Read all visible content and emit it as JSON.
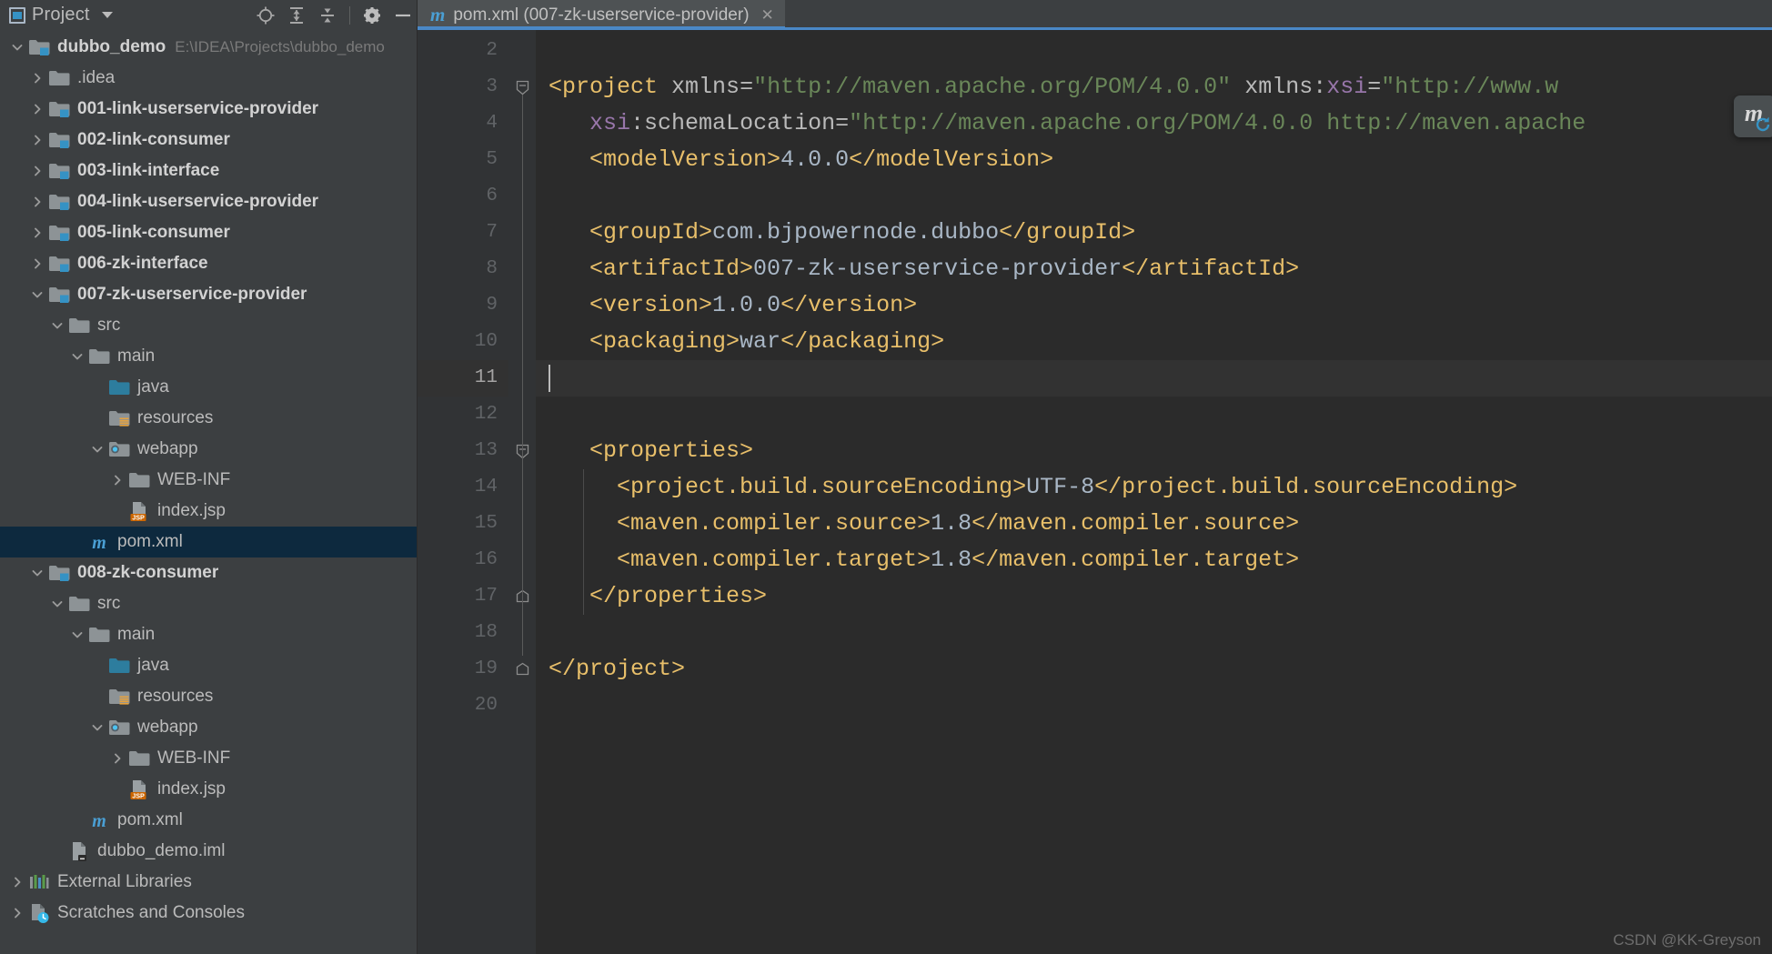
{
  "panel": {
    "title": "Project",
    "window_icon": "project-window-icon",
    "dropdown_icon": "chevron-down-icon",
    "buttons": [
      {
        "name": "locate-icon",
        "label": "Select Opened File"
      },
      {
        "name": "expand-all-icon",
        "label": "Expand All"
      },
      {
        "name": "collapse-all-icon",
        "label": "Collapse All"
      },
      {
        "name": "gear-icon",
        "label": "Settings"
      },
      {
        "name": "minimize-icon",
        "label": "Hide"
      }
    ]
  },
  "tree": [
    {
      "label": "dubbo_demo",
      "hint": "E:\\IDEA\\Projects\\dubbo_demo",
      "indent": 0,
      "arrow": "down",
      "icon": "module-folder",
      "bold": true,
      "selected": false
    },
    {
      "label": ".idea",
      "hint": "",
      "indent": 1,
      "arrow": "right",
      "icon": "folder",
      "bold": false,
      "selected": false
    },
    {
      "label": "001-link-userservice-provider",
      "hint": "",
      "indent": 1,
      "arrow": "right",
      "icon": "module-folder",
      "bold": true,
      "selected": false
    },
    {
      "label": "002-link-consumer",
      "hint": "",
      "indent": 1,
      "arrow": "right",
      "icon": "module-folder",
      "bold": true,
      "selected": false
    },
    {
      "label": "003-link-interface",
      "hint": "",
      "indent": 1,
      "arrow": "right",
      "icon": "module-folder",
      "bold": true,
      "selected": false
    },
    {
      "label": "004-link-userservice-provider",
      "hint": "",
      "indent": 1,
      "arrow": "right",
      "icon": "module-folder",
      "bold": true,
      "selected": false
    },
    {
      "label": "005-link-consumer",
      "hint": "",
      "indent": 1,
      "arrow": "right",
      "icon": "module-folder",
      "bold": true,
      "selected": false
    },
    {
      "label": "006-zk-interface",
      "hint": "",
      "indent": 1,
      "arrow": "right",
      "icon": "module-folder",
      "bold": true,
      "selected": false
    },
    {
      "label": "007-zk-userservice-provider",
      "hint": "",
      "indent": 1,
      "arrow": "down",
      "icon": "module-folder",
      "bold": true,
      "selected": false
    },
    {
      "label": "src",
      "hint": "",
      "indent": 2,
      "arrow": "down",
      "icon": "folder",
      "bold": false,
      "selected": false
    },
    {
      "label": "main",
      "hint": "",
      "indent": 3,
      "arrow": "down",
      "icon": "folder",
      "bold": false,
      "selected": false
    },
    {
      "label": "java",
      "hint": "",
      "indent": 4,
      "arrow": "none",
      "icon": "source-folder",
      "bold": false,
      "selected": false
    },
    {
      "label": "resources",
      "hint": "",
      "indent": 4,
      "arrow": "none",
      "icon": "resources-folder",
      "bold": false,
      "selected": false
    },
    {
      "label": "webapp",
      "hint": "",
      "indent": 4,
      "arrow": "down",
      "icon": "webapp-folder",
      "bold": false,
      "selected": false
    },
    {
      "label": "WEB-INF",
      "hint": "",
      "indent": 5,
      "arrow": "right",
      "icon": "folder",
      "bold": false,
      "selected": false
    },
    {
      "label": "index.jsp",
      "hint": "",
      "indent": 5,
      "arrow": "none",
      "icon": "jsp-file",
      "bold": false,
      "selected": false
    },
    {
      "label": "pom.xml",
      "hint": "",
      "indent": 3,
      "arrow": "none",
      "icon": "maven-file",
      "bold": false,
      "selected": true
    },
    {
      "label": "008-zk-consumer",
      "hint": "",
      "indent": 1,
      "arrow": "down",
      "icon": "module-folder",
      "bold": true,
      "selected": false
    },
    {
      "label": "src",
      "hint": "",
      "indent": 2,
      "arrow": "down",
      "icon": "folder",
      "bold": false,
      "selected": false
    },
    {
      "label": "main",
      "hint": "",
      "indent": 3,
      "arrow": "down",
      "icon": "folder",
      "bold": false,
      "selected": false
    },
    {
      "label": "java",
      "hint": "",
      "indent": 4,
      "arrow": "none",
      "icon": "source-folder",
      "bold": false,
      "selected": false
    },
    {
      "label": "resources",
      "hint": "",
      "indent": 4,
      "arrow": "none",
      "icon": "resources-folder",
      "bold": false,
      "selected": false
    },
    {
      "label": "webapp",
      "hint": "",
      "indent": 4,
      "arrow": "down",
      "icon": "webapp-folder",
      "bold": false,
      "selected": false
    },
    {
      "label": "WEB-INF",
      "hint": "",
      "indent": 5,
      "arrow": "right",
      "icon": "folder",
      "bold": false,
      "selected": false
    },
    {
      "label": "index.jsp",
      "hint": "",
      "indent": 5,
      "arrow": "none",
      "icon": "jsp-file",
      "bold": false,
      "selected": false
    },
    {
      "label": "pom.xml",
      "hint": "",
      "indent": 3,
      "arrow": "none",
      "icon": "maven-file",
      "bold": false,
      "selected": false
    },
    {
      "label": "dubbo_demo.iml",
      "hint": "",
      "indent": 2,
      "arrow": "none",
      "icon": "iml-file",
      "bold": false,
      "selected": false
    },
    {
      "label": "External Libraries",
      "hint": "",
      "indent": 0,
      "arrow": "right",
      "icon": "libraries",
      "bold": false,
      "selected": false
    },
    {
      "label": "Scratches and Consoles",
      "hint": "",
      "indent": 0,
      "arrow": "right",
      "icon": "scratches",
      "bold": false,
      "selected": false
    }
  ],
  "editor": {
    "tab": {
      "icon": "maven-file-icon",
      "label": "pom.xml (007-zk-userservice-provider)",
      "close_label": "✕"
    },
    "current_line": 11,
    "caret_line_number": 11,
    "lines": [
      {
        "n": 2,
        "segments": []
      },
      {
        "n": 3,
        "fold": "collapse",
        "segments": [
          {
            "c": "tg",
            "t": "<project"
          },
          {
            "c": "tx",
            "t": " "
          },
          {
            "c": "at",
            "t": "xmlns"
          },
          {
            "c": "eq",
            "t": "="
          },
          {
            "c": "st",
            "t": "\"http://maven.apache.org/POM/4.0.0\""
          },
          {
            "c": "tx",
            "t": " "
          },
          {
            "c": "at",
            "t": "xmlns"
          },
          {
            "c": "eq",
            "t": ":"
          },
          {
            "c": "ns",
            "t": "xsi"
          },
          {
            "c": "eq",
            "t": "="
          },
          {
            "c": "st",
            "t": "\"http://www.w"
          }
        ]
      },
      {
        "n": 4,
        "segments": [
          {
            "c": "tx",
            "t": "   "
          },
          {
            "c": "ns",
            "t": "xsi"
          },
          {
            "c": "eq",
            "t": ":"
          },
          {
            "c": "at",
            "t": "schemaLocation"
          },
          {
            "c": "eq",
            "t": "="
          },
          {
            "c": "st",
            "t": "\"http://maven.apache.org/POM/4.0.0 http://maven.apache"
          }
        ]
      },
      {
        "n": 5,
        "segments": [
          {
            "c": "tx",
            "t": "   "
          },
          {
            "c": "tg",
            "t": "<modelVersion>"
          },
          {
            "c": "tx",
            "t": "4.0.0"
          },
          {
            "c": "tg",
            "t": "</modelVersion>"
          }
        ]
      },
      {
        "n": 6,
        "segments": []
      },
      {
        "n": 7,
        "segments": [
          {
            "c": "tx",
            "t": "   "
          },
          {
            "c": "tg",
            "t": "<groupId>"
          },
          {
            "c": "tx",
            "t": "com.bjpowernode.dubbo"
          },
          {
            "c": "tg",
            "t": "</groupId>"
          }
        ]
      },
      {
        "n": 8,
        "segments": [
          {
            "c": "tx",
            "t": "   "
          },
          {
            "c": "tg",
            "t": "<artifactId>"
          },
          {
            "c": "tx",
            "t": "007-zk-userservice-provider"
          },
          {
            "c": "tg",
            "t": "</artifactId>"
          }
        ]
      },
      {
        "n": 9,
        "segments": [
          {
            "c": "tx",
            "t": "   "
          },
          {
            "c": "tg",
            "t": "<version>"
          },
          {
            "c": "tx",
            "t": "1.0.0"
          },
          {
            "c": "tg",
            "t": "</version>"
          }
        ]
      },
      {
        "n": 10,
        "segments": [
          {
            "c": "tx",
            "t": "   "
          },
          {
            "c": "tg",
            "t": "<packaging>"
          },
          {
            "c": "tx",
            "t": "war"
          },
          {
            "c": "tg",
            "t": "</packaging>"
          }
        ]
      },
      {
        "n": 11,
        "segments": []
      },
      {
        "n": 12,
        "segments": []
      },
      {
        "n": 13,
        "fold": "collapse",
        "segments": [
          {
            "c": "tx",
            "t": "   "
          },
          {
            "c": "tg",
            "t": "<properties>"
          }
        ]
      },
      {
        "n": 14,
        "segments": [
          {
            "c": "tx",
            "t": "     "
          },
          {
            "c": "tg",
            "t": "<project.build.sourceEncoding>"
          },
          {
            "c": "tx",
            "t": "UTF-8"
          },
          {
            "c": "tg",
            "t": "</project.build.sourceEncoding>"
          }
        ]
      },
      {
        "n": 15,
        "segments": [
          {
            "c": "tx",
            "t": "     "
          },
          {
            "c": "tg",
            "t": "<maven.compiler.source>"
          },
          {
            "c": "tx",
            "t": "1.8"
          },
          {
            "c": "tg",
            "t": "</maven.compiler.source>"
          }
        ]
      },
      {
        "n": 16,
        "segments": [
          {
            "c": "tx",
            "t": "     "
          },
          {
            "c": "tg",
            "t": "<maven.compiler.target>"
          },
          {
            "c": "tx",
            "t": "1.8"
          },
          {
            "c": "tg",
            "t": "</maven.compiler.target>"
          }
        ]
      },
      {
        "n": 17,
        "fold": "end",
        "segments": [
          {
            "c": "tx",
            "t": "   "
          },
          {
            "c": "tg",
            "t": "</properties>"
          }
        ]
      },
      {
        "n": 18,
        "segments": []
      },
      {
        "n": 19,
        "fold": "end",
        "segments": [
          {
            "c": "tg",
            "t": "</project>"
          }
        ]
      },
      {
        "n": 20,
        "segments": []
      }
    ]
  },
  "maven_popup": {
    "name": "maven-reload-button",
    "glyph": "m"
  },
  "watermark": "CSDN @KK-Greyson",
  "colors": {
    "panel_bg": "#3c3f41",
    "editor_bg": "#2b2b2b",
    "gutter_bg": "#313335",
    "selection_bg": "#0d293e",
    "tab_bg": "#4e5254",
    "tab_underline": "#4a88c7",
    "tag": "#e8bf6a",
    "string": "#6a8759",
    "namespace": "#9876aa",
    "text": "#a9b7c6",
    "line_number": "#606366",
    "jsp_badge": "#cc6600",
    "maven_icon": "#4a9fd4"
  }
}
